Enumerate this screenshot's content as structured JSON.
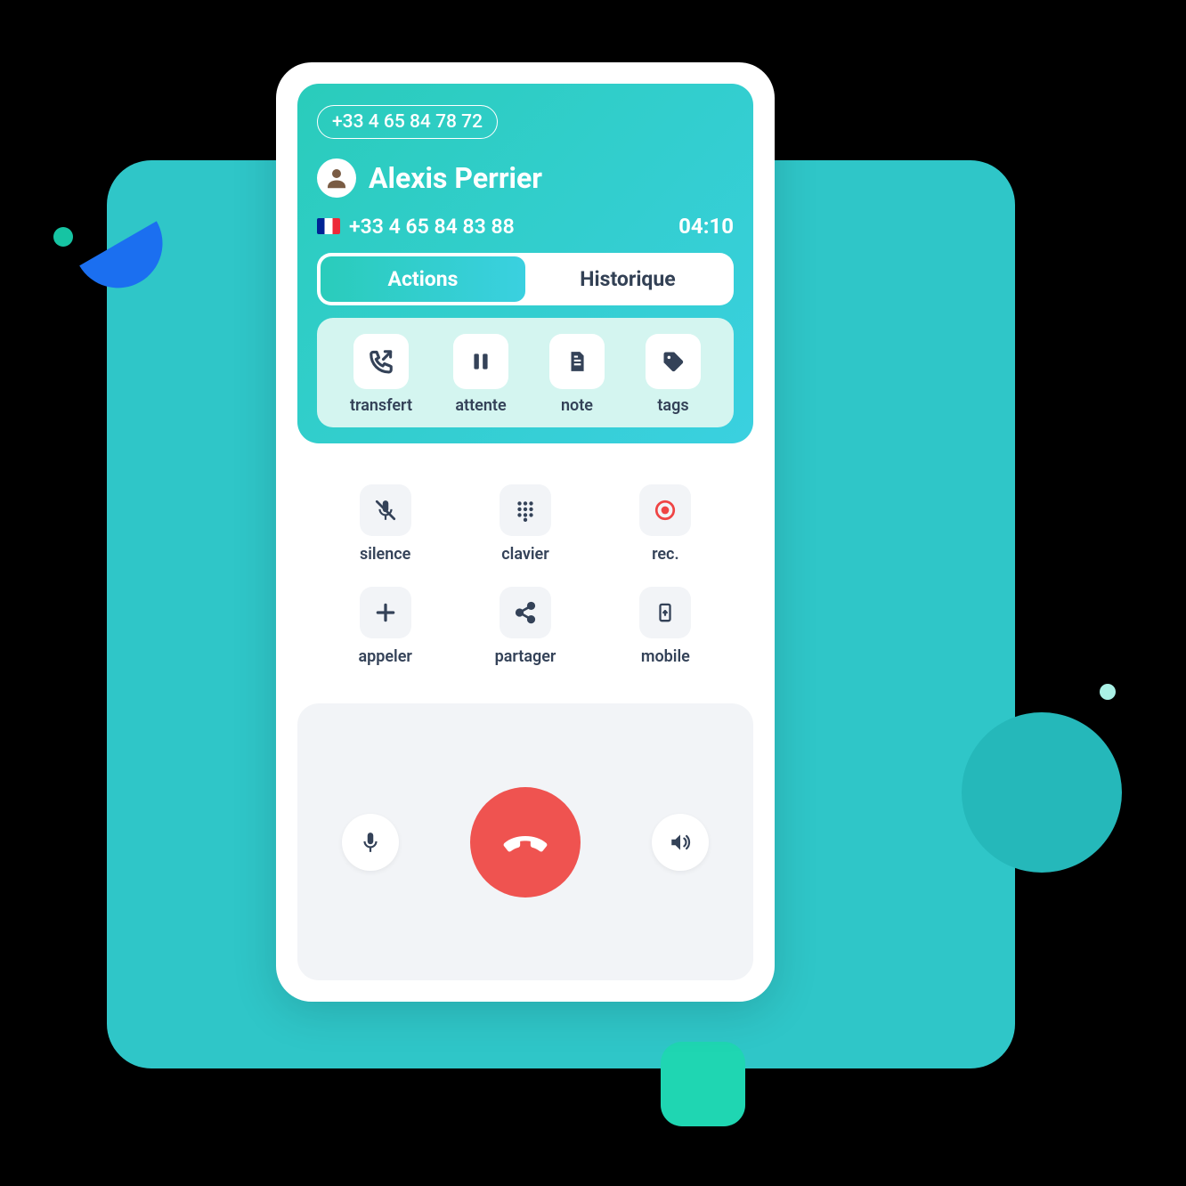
{
  "header": {
    "line_number": "+33 4 65 84 78 72",
    "contact_name": "Alexis Perrier",
    "contact_number": "+33 4 65 84 83 88",
    "duration": "04:10"
  },
  "tabs": {
    "actions": "Actions",
    "history": "Historique"
  },
  "actions": {
    "transfer": "transfert",
    "hold": "attente",
    "note": "note",
    "tags": "tags"
  },
  "secondary": {
    "mute": "silence",
    "keypad": "clavier",
    "record": "rec.",
    "call": "appeler",
    "share": "partager",
    "mobile": "mobile"
  }
}
